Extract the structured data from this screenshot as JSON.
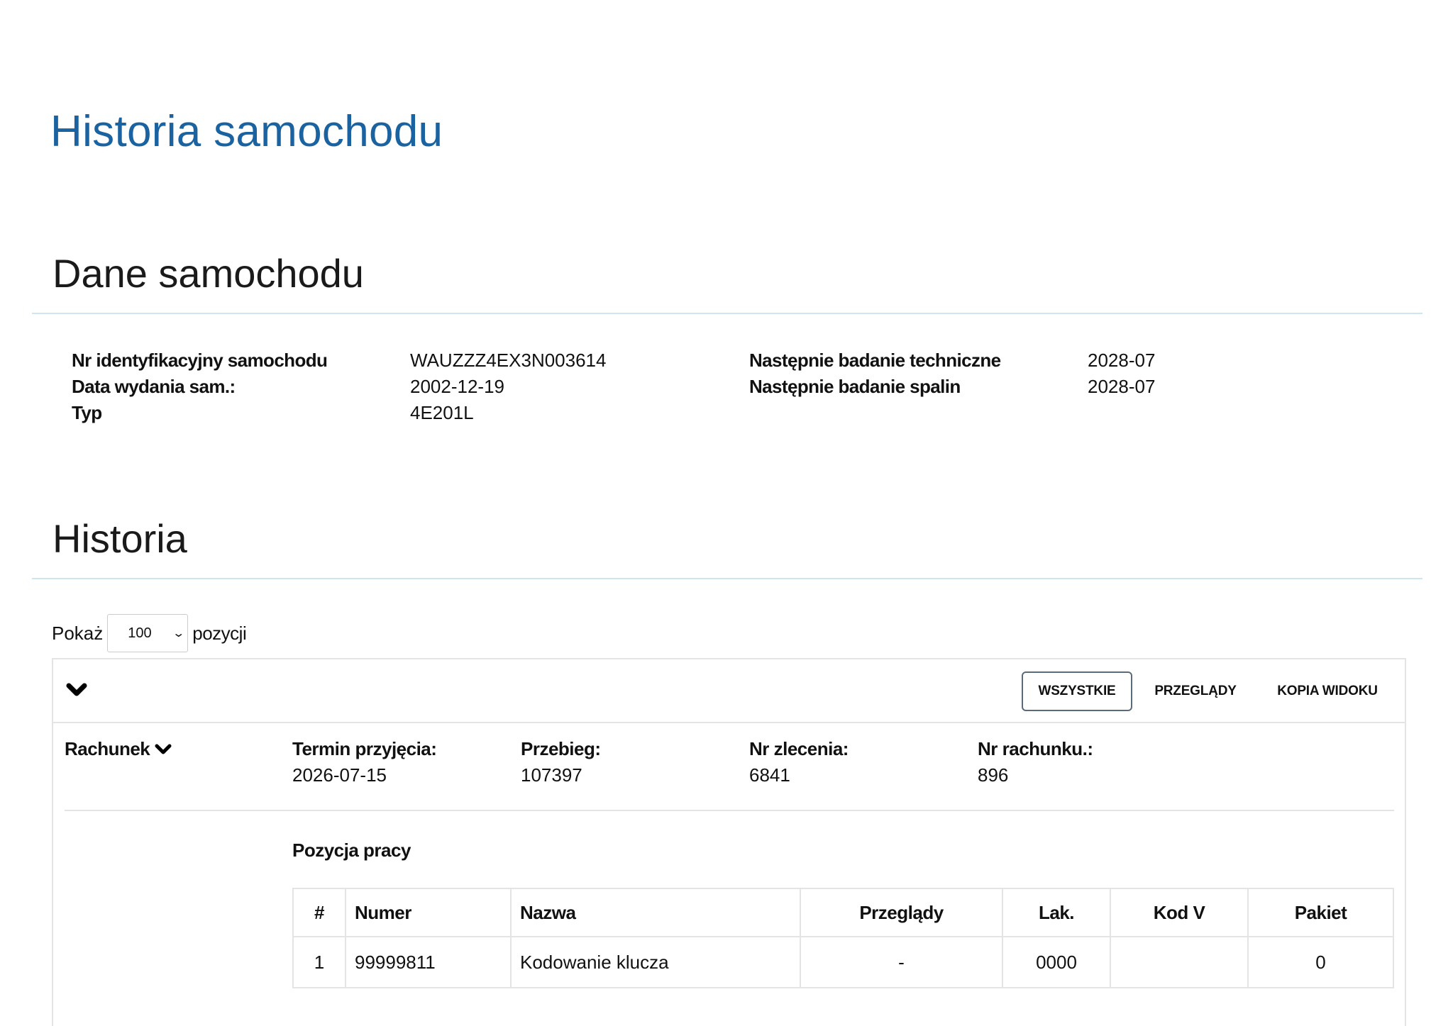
{
  "page_title": "Historia samochodu",
  "car_section": {
    "title": "Dane samochodu",
    "left_fields": [
      {
        "label": "Nr identyfikacyjny samochodu",
        "value": "WAUZZZ4EX3N003614"
      },
      {
        "label": "Data wydania sam.:",
        "value": "2002-12-19"
      },
      {
        "label": "Typ",
        "value": "4E201L"
      }
    ],
    "right_fields": [
      {
        "label": "Następnie badanie techniczne",
        "value": "2028-07"
      },
      {
        "label": "Następnie badanie spalin",
        "value": "2028-07"
      }
    ]
  },
  "history_section": {
    "title": "Historia",
    "show_prefix": "Pokaż",
    "show_value": "100",
    "show_suffix": "pozycji"
  },
  "toolbar": {
    "all_label": "WSZYSTKIE",
    "reviews_label": "PRZEGLĄDY",
    "copy_view_label": "KOPIA WIDOKU"
  },
  "bill": {
    "title": "Rachunek",
    "fields": [
      {
        "label": "Termin przyjęcia:",
        "value": "2026-07-15"
      },
      {
        "label": "Przebieg:",
        "value": "107397"
      },
      {
        "label": "Nr zlecenia:",
        "value": "6841"
      },
      {
        "label": "Nr rachunku.:",
        "value": "896"
      }
    ]
  },
  "work": {
    "title": "Pozycja pracy",
    "columns": [
      "#",
      "Numer",
      "Nazwa",
      "Przeglądy",
      "Lak.",
      "Kod V",
      "Pakiet"
    ],
    "rows": [
      [
        "1",
        "99999811",
        "Kodowanie klucza",
        "-",
        "0000",
        "",
        "0"
      ]
    ]
  }
}
